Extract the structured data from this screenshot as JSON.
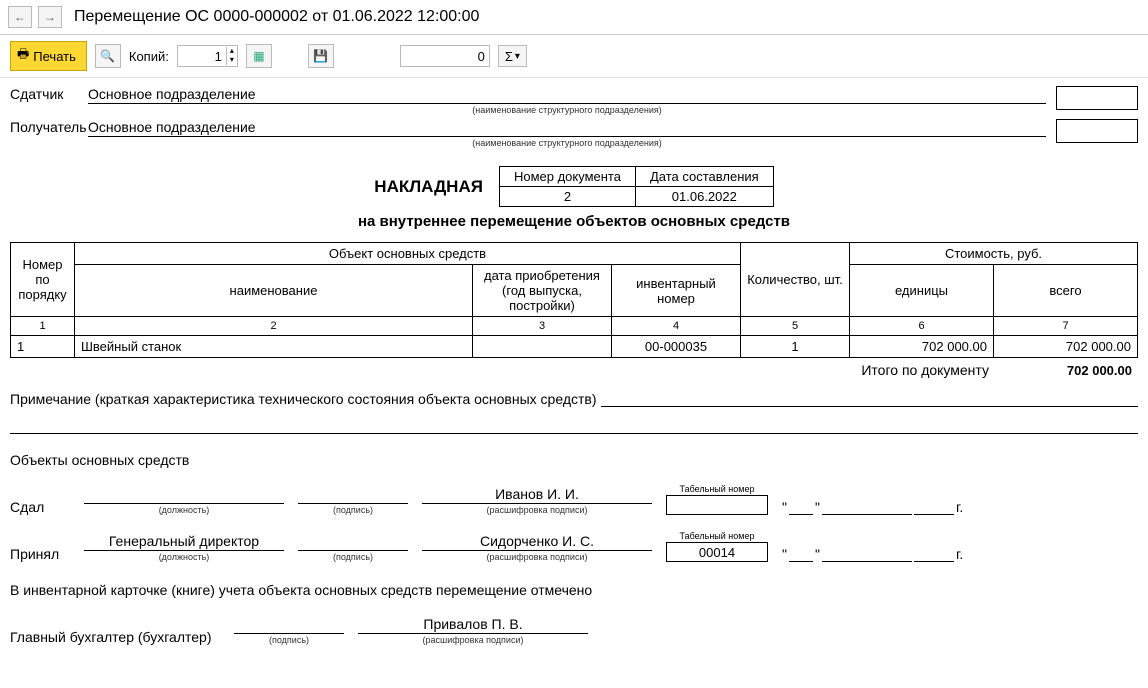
{
  "header": {
    "title": "Перемещение ОС 0000-000002 от 01.06.2022 12:00:00"
  },
  "toolbar": {
    "print_label": "Печать",
    "copies_label": "Копий:",
    "copies_value": "1",
    "num_value": "0",
    "sigma": "Σ"
  },
  "doc": {
    "sender_label": "Сдатчик",
    "sender_value": "Основное подразделение",
    "receiver_label": "Получатель",
    "receiver_value": "Основное подразделение",
    "unit_hint": "(наименование структурного подразделения)",
    "title": "НАКЛАДНАЯ",
    "subtitle": "на внутреннее перемещение объектов основных средств",
    "doc_num_label": "Номер документа",
    "doc_num_value": "2",
    "doc_date_label": "Дата составления",
    "doc_date_value": "01.06.2022"
  },
  "table": {
    "head": {
      "num": "Номер по порядку",
      "object": "Объект основных средств",
      "name": "наименование",
      "acq": "дата приобретения (год выпуска, постройки)",
      "inv": "инвентарный номер",
      "qty": "Количество, шт.",
      "cost": "Стоимость, руб.",
      "unit_cost": "единицы",
      "total_cost": "всего"
    },
    "cols": [
      "1",
      "2",
      "3",
      "4",
      "5",
      "6",
      "7"
    ],
    "rows": [
      {
        "num": "1",
        "name": "Швейный станок",
        "acq": "",
        "inv": "00-000035",
        "qty": "1",
        "unit": "702 000.00",
        "total": "702 000.00"
      }
    ],
    "total_label": "Итого по документу",
    "total_value": "702 000.00"
  },
  "note": {
    "label": "Примечание (краткая характеристика технического состояния объекта основных средств)"
  },
  "section": {
    "objects_label": "Объекты основных средств",
    "tab_num_label": "Табельный номер",
    "sdal_label": "Сдал",
    "prinyal_label": "Принял",
    "position_hint": "(должность)",
    "sign_hint": "(подпись)",
    "decode_hint": "(расшифровка подписи)",
    "sdal_name": "Иванов И. И.",
    "sdal_tab": "",
    "prinyal_position": "Генеральный директор",
    "prinyal_name": "Сидорченко И. С.",
    "prinyal_tab": "00014",
    "card_note": "В инвентарной карточке (книге) учета объекта основных средств перемещение отмечено",
    "accountant_label": "Главный бухгалтер (бухгалтер)",
    "accountant_name": "Привалов П. В.",
    "year_suffix": "г.",
    "quote": "\""
  }
}
